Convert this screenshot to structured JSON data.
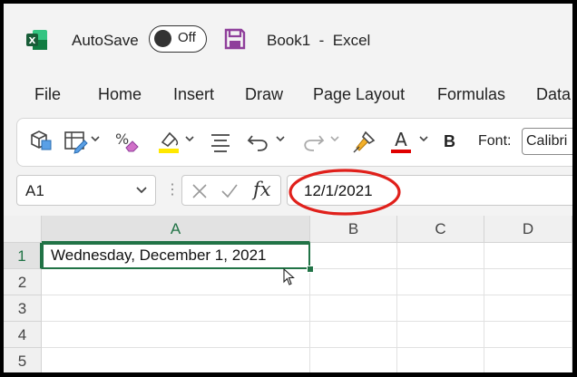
{
  "titlebar": {
    "autosave_label": "AutoSave",
    "autosave_state": "Off",
    "document_title": "Book1  -  Excel"
  },
  "menu": {
    "tabs": [
      "File",
      "Home",
      "Insert",
      "Draw",
      "Page Layout",
      "Formulas",
      "Data"
    ]
  },
  "toolbar": {
    "bold_label": "B",
    "font_label": "Font:",
    "font_value": "Calibri"
  },
  "formula_bar": {
    "name_box": "A1",
    "fx_label": "fx",
    "formula": "12/1/2021"
  },
  "grid": {
    "columns": [
      "A",
      "B",
      "C",
      "D"
    ],
    "rows": [
      "1",
      "2",
      "3",
      "4",
      "5"
    ],
    "cell_a1": "Wednesday, December 1, 2021"
  },
  "colors": {
    "excel_green": "#217346",
    "save_purple": "#8f3f9b",
    "annotation_red": "#e0201b",
    "font_color_red": "#e00000",
    "highlight_yellow": "#ffe800"
  }
}
